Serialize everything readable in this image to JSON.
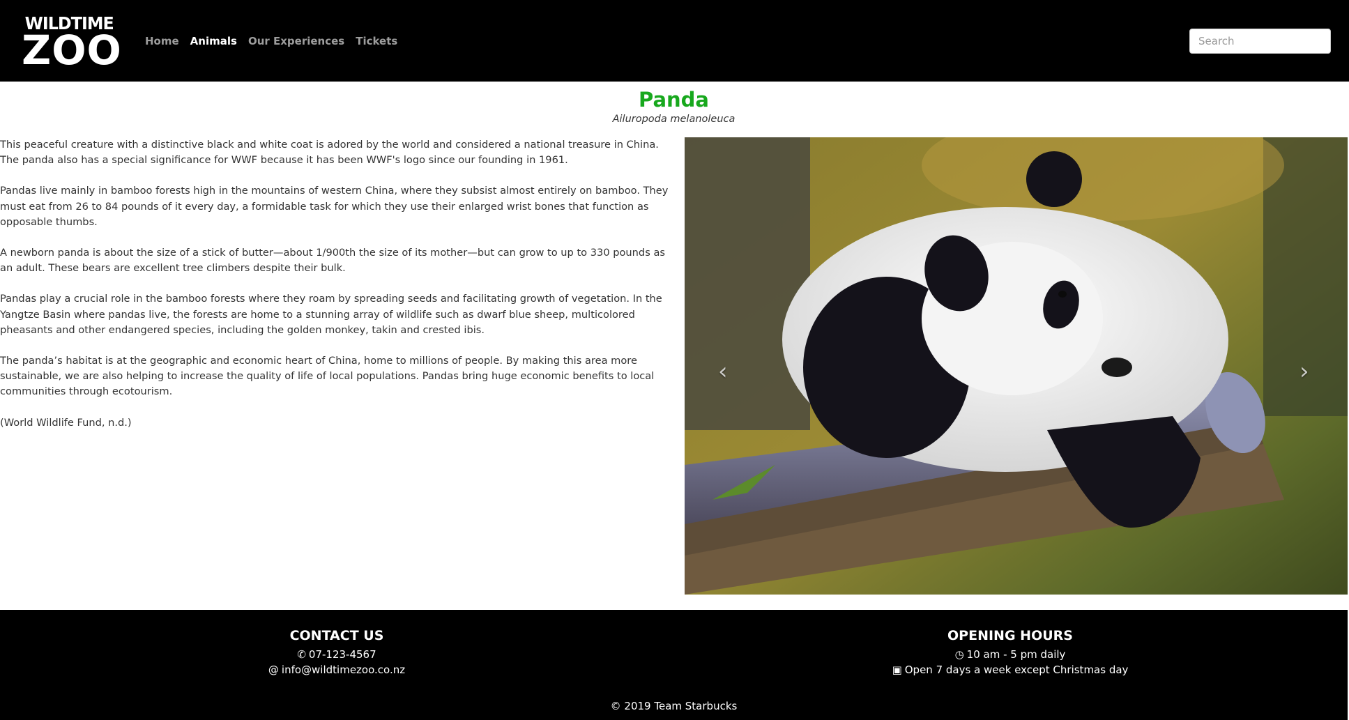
{
  "brand": {
    "line1": "WILDTIME",
    "line2": "ZOO"
  },
  "nav": {
    "items": [
      {
        "label": "Home",
        "active": false
      },
      {
        "label": "Animals",
        "active": true
      },
      {
        "label": "Our Experiences",
        "active": false
      },
      {
        "label": "Tickets",
        "active": false
      }
    ]
  },
  "search": {
    "placeholder": "Search"
  },
  "animal": {
    "name": "Panda",
    "scientific_name": "Ailuropoda melanoleuca",
    "paragraphs": [
      "This peaceful creature with a distinctive black and white coat is adored by the world and considered a national treasure in China. The panda also has a special significance for WWF because it has been WWF's logo since our founding in 1961.",
      "Pandas live mainly in bamboo forests high in the mountains of western China, where they subsist almost entirely on bamboo. They must eat from 26 to 84 pounds of it every day, a formidable task for which they use their enlarged wrist bones that function as opposable thumbs.",
      "A newborn panda is about the size of a stick of butter—about 1/900th the size of its mother—but can grow to up to 330 pounds as an adult. These bears are excellent tree climbers despite their bulk.",
      "Pandas play a crucial role in the bamboo forests where they roam by spreading seeds and facilitating growth of vegetation. In the Yangtze Basin where pandas live, the forests are home to a stunning array of wildlife such as dwarf blue sheep, multicolored pheasants and other endangered species, including the golden monkey, takin and crested ibis.",
      "The panda’s habitat is at the geographic and economic heart of China, home to millions of people. By making this area more sustainable, we are also helping to increase the quality of life of local populations. Pandas bring huge economic benefits to local communities through ecotourism.",
      "(World Wildlife Fund, n.d.)"
    ]
  },
  "carousel": {
    "prev_icon": "chevron-left-icon",
    "next_icon": "chevron-right-icon"
  },
  "footer": {
    "contact": {
      "heading": "CONTACT US",
      "phone_icon": "phone-icon",
      "phone": "07-123-4567",
      "email_icon": "at-icon",
      "email": "info@wildtimezoo.co.nz"
    },
    "hours": {
      "heading": "OPENING HOURS",
      "clock_icon": "clock-icon",
      "daily": "10 am - 5 pm daily",
      "calendar_icon": "calendar-icon",
      "days": "Open 7 days a week except Christmas day"
    },
    "copyright": "© 2019 Team Starbucks"
  },
  "colors": {
    "accent": "#17a81d",
    "nav_bg": "#000000",
    "nav_text": "#9d9d9d",
    "nav_active": "#ffffff"
  }
}
